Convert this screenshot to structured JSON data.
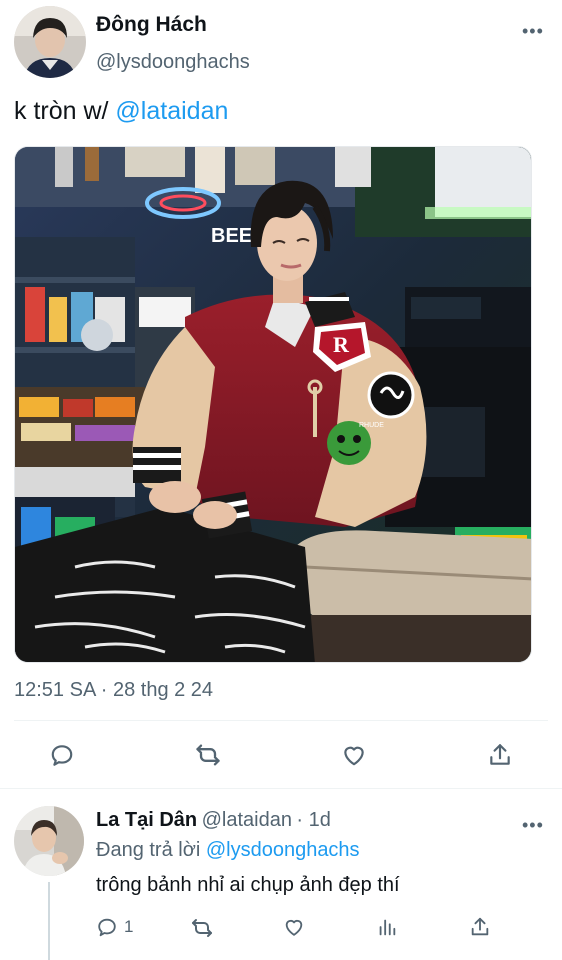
{
  "tweet": {
    "display_name": "Đông Hách",
    "handle": "@lysdoonghachs",
    "text_prefix": "k tròn w/ ",
    "mention": "@lataidan",
    "timestamp": "12:51 SA · 28 thg 2 24",
    "photo_sign_text": "BEER",
    "photo_patch_text": "RHUDE"
  },
  "tweet_actions": [
    {
      "icon": "reply-icon"
    },
    {
      "icon": "retweet-icon"
    },
    {
      "icon": "like-icon"
    },
    {
      "icon": "share-icon"
    }
  ],
  "reply": {
    "display_name": "La Tại Dân",
    "handle": "@lataidan",
    "age": "· 1d",
    "replying_prefix": "Đang trả lời ",
    "replying_to": "@lysdoonghachs",
    "text": "trông bảnh nhỉ ai chụp ảnh đẹp thí",
    "reply_count": "1"
  },
  "colors": {
    "accent": "#1d9bf0",
    "secondary_text": "#536471",
    "primary_text": "#0f1419"
  }
}
